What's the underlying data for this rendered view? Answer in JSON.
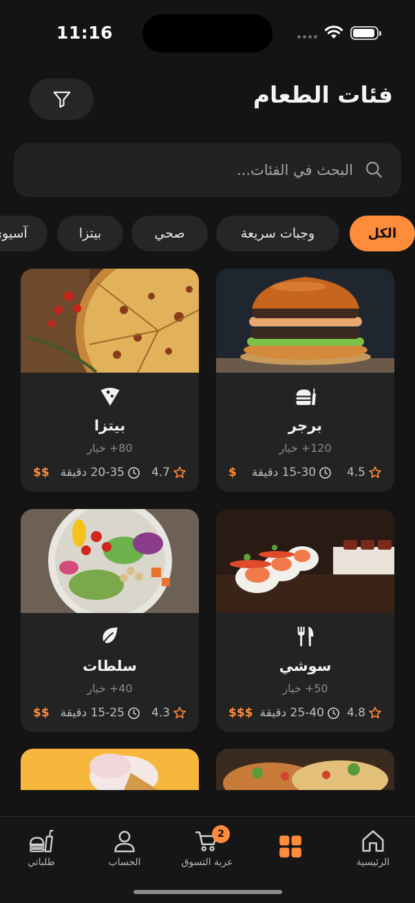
{
  "status_bar": {
    "time": "11:16"
  },
  "header": {
    "title": "فئات الطعام"
  },
  "search": {
    "placeholder": "البحث في الفئات..."
  },
  "chips": [
    "الكل",
    "وجبات سريعة",
    "صحي",
    "بيتزا",
    "آسيوي"
  ],
  "active_chip": "الكل",
  "cards": [
    {
      "name": "برجر",
      "icon": "burger-icon",
      "count": "120+ خيار",
      "rating": "4.5",
      "time": "15-30 دقيقة",
      "price": "$"
    },
    {
      "name": "بيتزا",
      "icon": "pizza-slice-icon",
      "count": "80+ خيار",
      "rating": "4.7",
      "time": "20-35 دقيقة",
      "price": "$$"
    },
    {
      "name": "سوشي",
      "icon": "utensils-icon",
      "count": "50+ خيار",
      "rating": "4.8",
      "time": "25-40 دقيقة",
      "price": "$$$"
    },
    {
      "name": "سلطات",
      "icon": "leaf-icon",
      "count": "40+ خيار",
      "rating": "4.3",
      "time": "15-25 دقيقة",
      "price": "$$"
    }
  ],
  "nav": {
    "home": "الرئيسية",
    "categories": "",
    "cart": "عربة التسوق",
    "cart_badge": "2",
    "account": "الحساب",
    "orders": "طلباتي"
  },
  "colors": {
    "accent": "#ff8c3a",
    "background": "#141414",
    "card": "#232323"
  }
}
